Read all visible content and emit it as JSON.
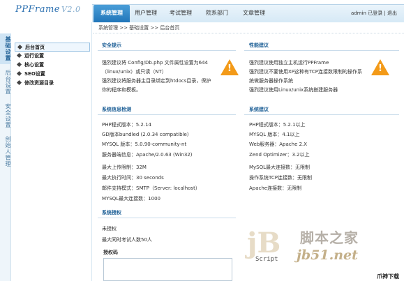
{
  "app": {
    "logo": "PPFrame",
    "version": "V2.0"
  },
  "nav": {
    "tabs": [
      "系统管理",
      "用户管理",
      "考试管理",
      "院系部门",
      "文章管理"
    ],
    "user": "admin 已登录 | 退出"
  },
  "left_tabs": [
    "基础设置",
    "后台设置",
    "安全设置",
    "创始人管理"
  ],
  "menu": [
    "后台首页",
    "运行设置",
    "核心设置",
    "SEO设置",
    "修改资源目录"
  ],
  "breadcrumb": "系统管理 >> 基础设置 >> 后台首页",
  "security": {
    "title": "安全提示",
    "lines": [
      "强烈建议将 Config/Db.php 文件属性设置为644",
      "（linux/unix）或只读（NT）",
      "强烈建议将服务器主目录绑定到htdocs目录，保护",
      "你的程序和模板。"
    ]
  },
  "performance": {
    "title": "性能建议",
    "lines": [
      "强烈建议使用独立主机运行PPFrame",
      "强烈建议不要使用XP这种有TCP连接数限制的操作系",
      "统做服务器操作系统",
      "强烈建议使用Linux/unix系统搭建服务器"
    ]
  },
  "sysinfo": {
    "title": "系统信息检测",
    "lines": [
      "PHP程式版本：5.2.14",
      "GD版本bundled (2.0.34 compatible)",
      "MYSQL 版本：5.0.90-community-nt",
      "服务器端信息：Apache/2.0.63 (Win32)",
      "最大上传限制：32M",
      "最大执行时间：30 seconds",
      "邮件支持模式：SMTP（Server: localhost）",
      "MYSQL最大连接数：1000"
    ]
  },
  "sysadvice": {
    "title": "系统建议",
    "lines": [
      "PHP程式版本：5.2.1以上",
      "MYSQL 版本：4.1以上",
      "Web服务器：Apache 2.X",
      "Zend Optimizer：3.2以上",
      "MySQL最大连接数：无限制",
      "操作系统TCP连接数：无限制",
      "Apache连接数：无限制"
    ]
  },
  "license": {
    "title": "系统授权",
    "lines": [
      "未授权",
      "最大同时考试人数50人"
    ],
    "code_label": "授权码"
  },
  "watermark": {
    "cn": "脚本之家",
    "url": "jb51.net",
    "script": "Script",
    "corner": "爪神下载网"
  },
  "colors": {
    "accent": "#1f74b8",
    "title": "#1d5f96",
    "warning": "#f39a18"
  }
}
